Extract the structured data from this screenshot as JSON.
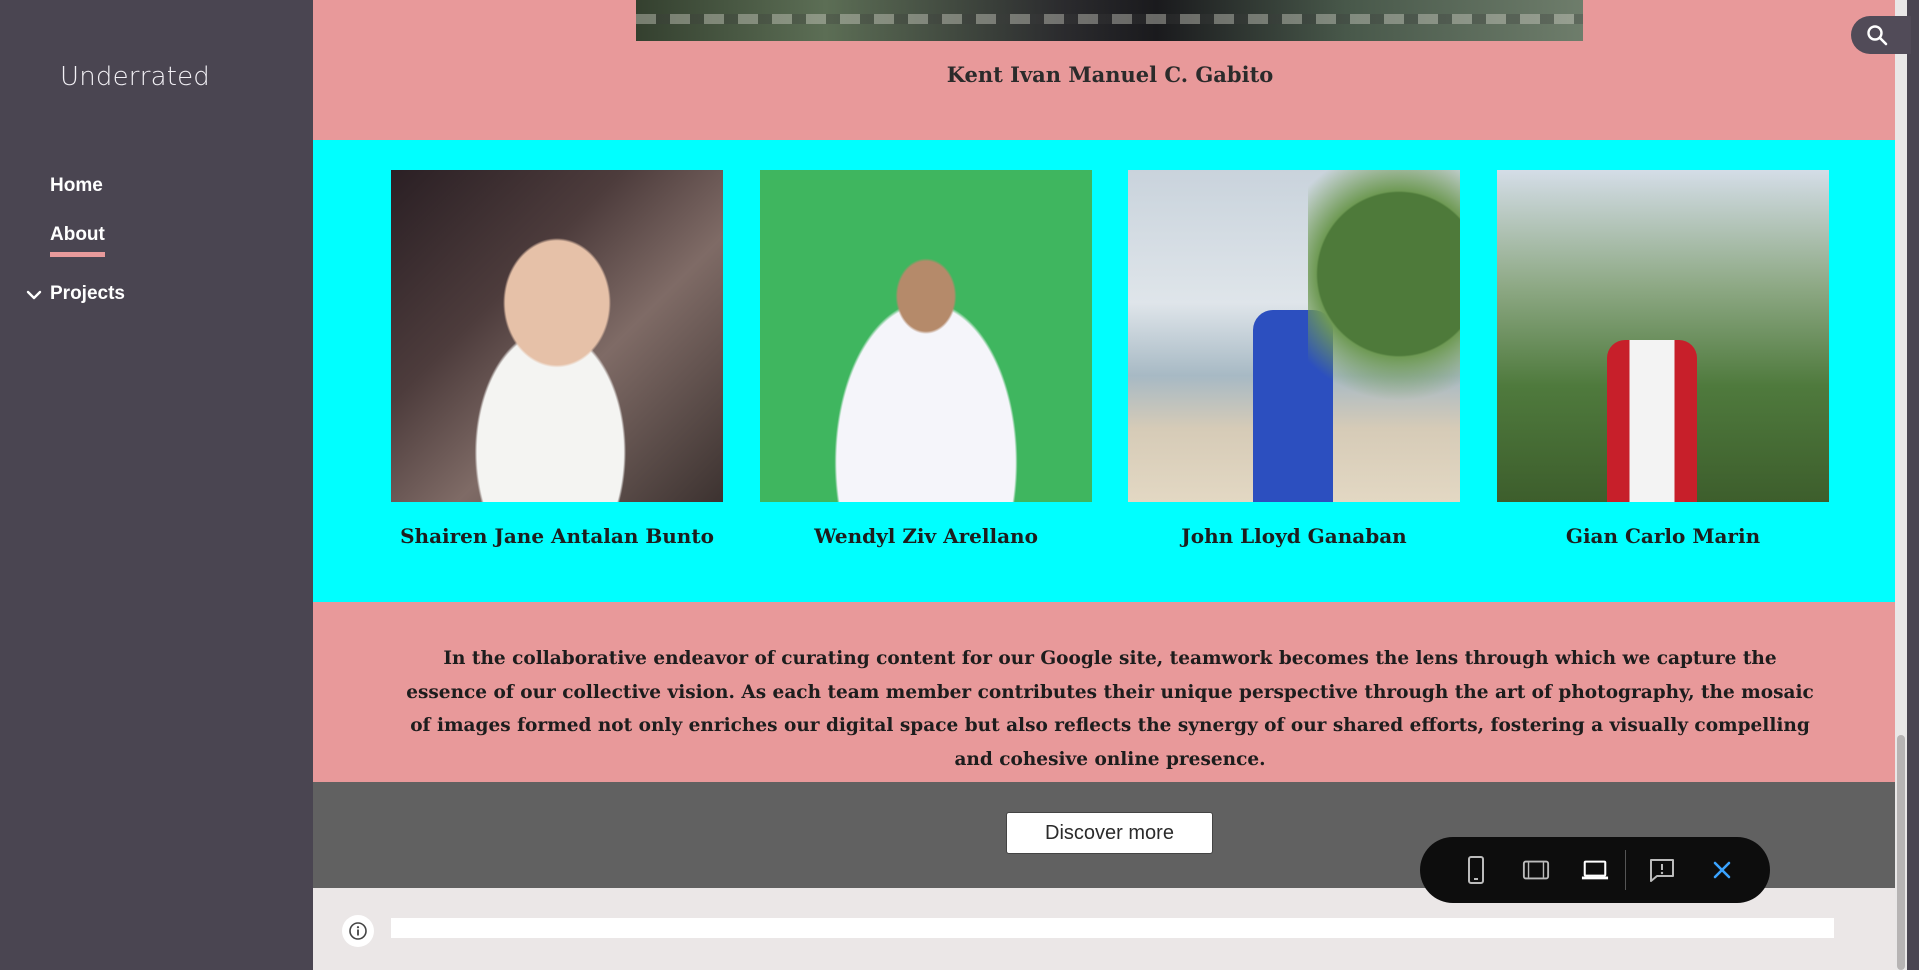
{
  "site": {
    "title": "Underrated"
  },
  "nav": {
    "home": "Home",
    "about": "About",
    "projects": "Projects"
  },
  "top": {
    "caption": "Kent Ivan Manuel C. Gabito"
  },
  "team": [
    {
      "name": "Shairen Jane Antalan Bunto"
    },
    {
      "name": "Wendyl Ziv Arellano"
    },
    {
      "name": "John Lloyd Ganaban"
    },
    {
      "name": "Gian Carlo Marin"
    }
  ],
  "paragraph": "In the collaborative endeavor of curating content for our Google site, teamwork becomes the lens through which we capture the essence of our collective vision. As each team member contributes their unique perspective through the art of photography, the mosaic of images formed not only enriches our digital space but also reflects the synergy of our shared efforts, fostering a visually compelling and cohesive online presence.",
  "cta": {
    "discover_label": "Discover more"
  },
  "colors": {
    "sidebar": "#4a4551",
    "section_pink": "#e8999a",
    "section_cyan": "#00ffff",
    "section_dark": "#616161",
    "accent_underline": "#e89a9b"
  },
  "icons": {
    "search": "search-icon",
    "chevron": "chevron-down-icon",
    "info": "info-icon",
    "phone": "phone-preview-icon",
    "tablet": "tablet-preview-icon",
    "laptop": "laptop-preview-icon",
    "feedback": "report-issue-icon",
    "close": "close-icon"
  }
}
